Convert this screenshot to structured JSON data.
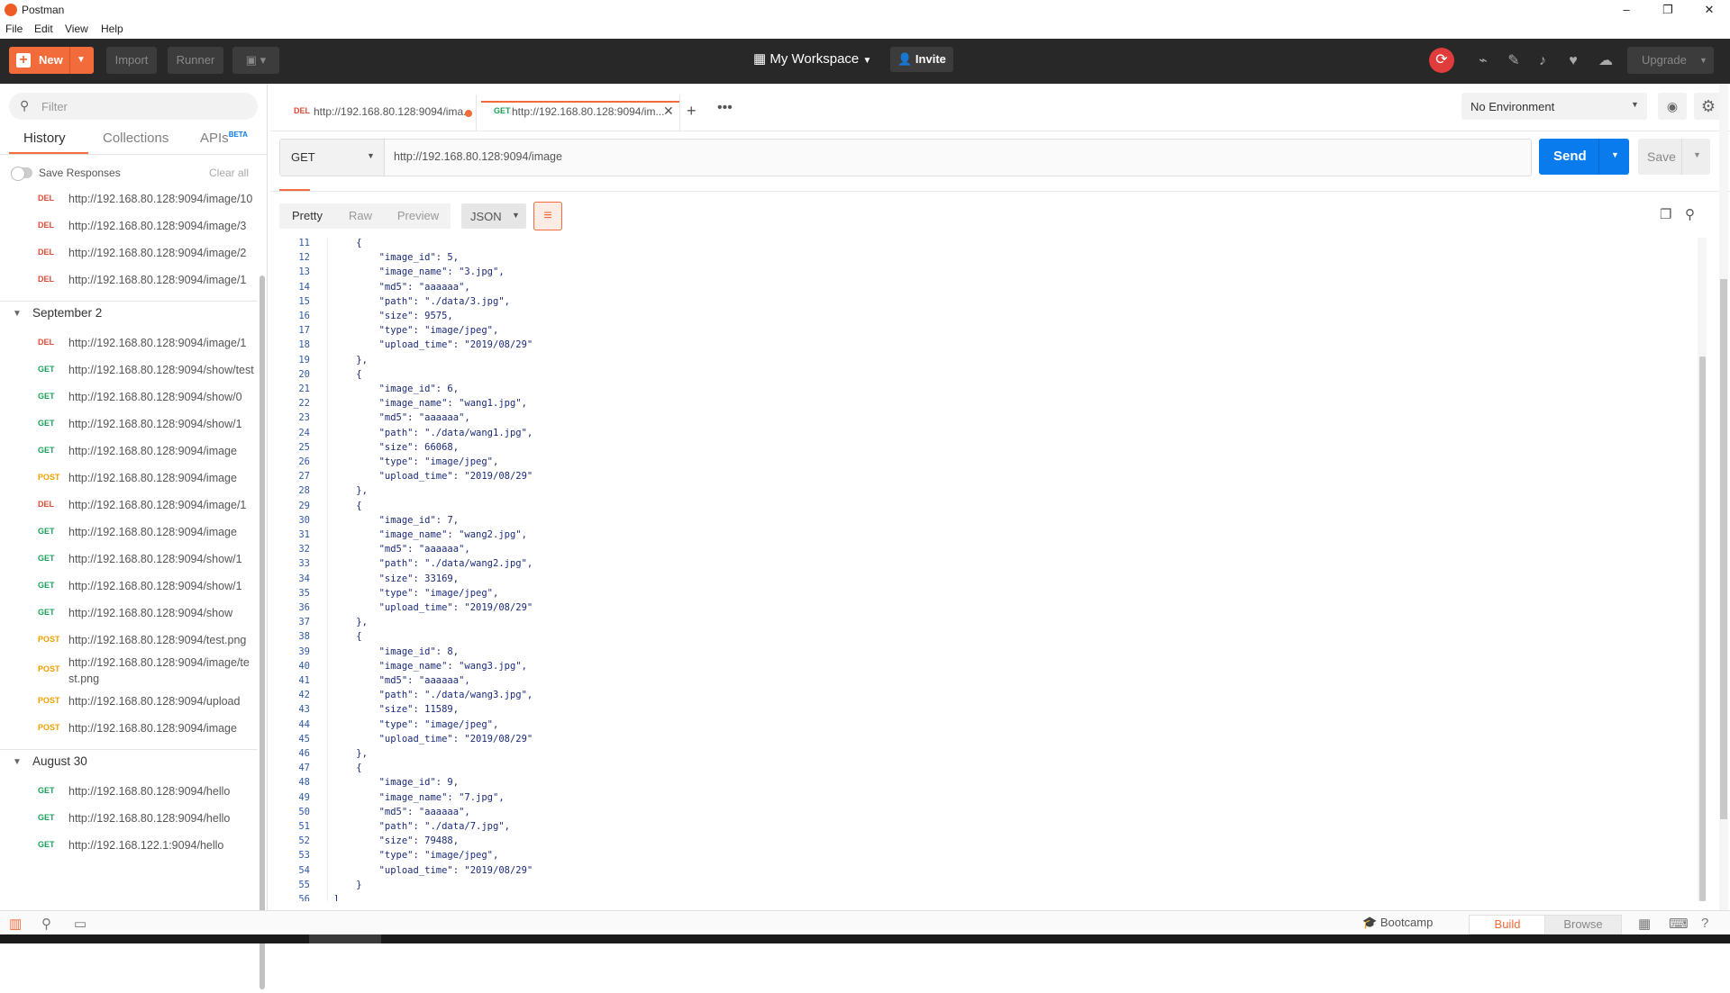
{
  "window": {
    "title": "Postman",
    "minimize": "–",
    "maximize": "❐",
    "close": "✕"
  },
  "menu": [
    "File",
    "Edit",
    "View",
    "Help"
  ],
  "toolbar": {
    "new_label": "New",
    "import_label": "Import",
    "runner_label": "Runner",
    "workspace_label": "My Workspace",
    "invite_label": "Invite",
    "upgrade_label": "Upgrade",
    "icons": [
      "sync-icon",
      "satellite-icon",
      "wrench-icon",
      "bell-icon",
      "heart-icon",
      "cloud-icon"
    ]
  },
  "sidebar": {
    "filter_placeholder": "Filter",
    "tabs": [
      "History",
      "Collections",
      "APIs"
    ],
    "apis_badge": "BETA",
    "save_responses": "Save Responses",
    "clear_all": "Clear all",
    "top_items": [
      {
        "method": "DEL",
        "url": "http://192.168.80.128:9094/image/10"
      },
      {
        "method": "DEL",
        "url": "http://192.168.80.128:9094/image/3"
      },
      {
        "method": "DEL",
        "url": "http://192.168.80.128:9094/image/2"
      },
      {
        "method": "DEL",
        "url": "http://192.168.80.128:9094/image/1"
      }
    ],
    "groups": [
      {
        "label": "September 2",
        "items": [
          {
            "method": "DEL",
            "url": "http://192.168.80.128:9094/image/1"
          },
          {
            "method": "GET",
            "url": "http://192.168.80.128:9094/show/test"
          },
          {
            "method": "GET",
            "url": "http://192.168.80.128:9094/show/0"
          },
          {
            "method": "GET",
            "url": "http://192.168.80.128:9094/show/1"
          },
          {
            "method": "GET",
            "url": "http://192.168.80.128:9094/image"
          },
          {
            "method": "POST",
            "url": "http://192.168.80.128:9094/image"
          },
          {
            "method": "DEL",
            "url": "http://192.168.80.128:9094/image/1"
          },
          {
            "method": "GET",
            "url": "http://192.168.80.128:9094/image"
          },
          {
            "method": "GET",
            "url": "http://192.168.80.128:9094/show/1"
          },
          {
            "method": "GET",
            "url": "http://192.168.80.128:9094/show/1"
          },
          {
            "method": "GET",
            "url": "http://192.168.80.128:9094/show"
          },
          {
            "method": "POST",
            "url": "http://192.168.80.128:9094/test.png"
          },
          {
            "method": "POST",
            "url": "http://192.168.80.128:9094/image/test.png"
          },
          {
            "method": "POST",
            "url": "http://192.168.80.128:9094/upload"
          },
          {
            "method": "POST",
            "url": "http://192.168.80.128:9094/image"
          }
        ]
      },
      {
        "label": "August 30",
        "items": [
          {
            "method": "GET",
            "url": "http://192.168.80.128:9094/hello"
          },
          {
            "method": "GET",
            "url": "http://192.168.80.128:9094/hello"
          },
          {
            "method": "GET",
            "url": "http://192.168.122.1:9094/hello"
          }
        ]
      }
    ]
  },
  "request_tabs": [
    {
      "method": "DEL",
      "url": "http://192.168.80.128:9094/ima..."
    },
    {
      "method": "GET",
      "url": "http://192.168.80.128:9094/im..."
    }
  ],
  "environment": {
    "selected": "No Environment"
  },
  "request": {
    "method": "GET",
    "url": "http://192.168.80.128:9094/image",
    "send_label": "Send",
    "save_label": "Save"
  },
  "response": {
    "view_tabs": [
      "Pretty",
      "Raw",
      "Preview"
    ],
    "active_view": "Pretty",
    "format": "JSON",
    "code_lines": [
      {
        "n": "11",
        "t": "    {"
      },
      {
        "n": "12",
        "t": "        \"image_id\": 5,"
      },
      {
        "n": "13",
        "t": "        \"image_name\": \"3.jpg\","
      },
      {
        "n": "14",
        "t": "        \"md5\": \"aaaaaa\","
      },
      {
        "n": "15",
        "t": "        \"path\": \"./data/3.jpg\","
      },
      {
        "n": "16",
        "t": "        \"size\": 9575,"
      },
      {
        "n": "17",
        "t": "        \"type\": \"image/jpeg\","
      },
      {
        "n": "18",
        "t": "        \"upload_time\": \"2019/08/29\""
      },
      {
        "n": "19",
        "t": "    },"
      },
      {
        "n": "20",
        "t": "    {"
      },
      {
        "n": "21",
        "t": "        \"image_id\": 6,"
      },
      {
        "n": "22",
        "t": "        \"image_name\": \"wang1.jpg\","
      },
      {
        "n": "23",
        "t": "        \"md5\": \"aaaaaa\","
      },
      {
        "n": "24",
        "t": "        \"path\": \"./data/wang1.jpg\","
      },
      {
        "n": "25",
        "t": "        \"size\": 66068,"
      },
      {
        "n": "26",
        "t": "        \"type\": \"image/jpeg\","
      },
      {
        "n": "27",
        "t": "        \"upload_time\": \"2019/08/29\""
      },
      {
        "n": "28",
        "t": "    },"
      },
      {
        "n": "29",
        "t": "    {"
      },
      {
        "n": "30",
        "t": "        \"image_id\": 7,"
      },
      {
        "n": "31",
        "t": "        \"image_name\": \"wang2.jpg\","
      },
      {
        "n": "32",
        "t": "        \"md5\": \"aaaaaa\","
      },
      {
        "n": "33",
        "t": "        \"path\": \"./data/wang2.jpg\","
      },
      {
        "n": "34",
        "t": "        \"size\": 33169,"
      },
      {
        "n": "35",
        "t": "        \"type\": \"image/jpeg\","
      },
      {
        "n": "36",
        "t": "        \"upload_time\": \"2019/08/29\""
      },
      {
        "n": "37",
        "t": "    },"
      },
      {
        "n": "38",
        "t": "    {"
      },
      {
        "n": "39",
        "t": "        \"image_id\": 8,"
      },
      {
        "n": "40",
        "t": "        \"image_name\": \"wang3.jpg\","
      },
      {
        "n": "41",
        "t": "        \"md5\": \"aaaaaa\","
      },
      {
        "n": "42",
        "t": "        \"path\": \"./data/wang3.jpg\","
      },
      {
        "n": "43",
        "t": "        \"size\": 11589,"
      },
      {
        "n": "44",
        "t": "        \"type\": \"image/jpeg\","
      },
      {
        "n": "45",
        "t": "        \"upload_time\": \"2019/08/29\""
      },
      {
        "n": "46",
        "t": "    },"
      },
      {
        "n": "47",
        "t": "    {"
      },
      {
        "n": "48",
        "t": "        \"image_id\": 9,"
      },
      {
        "n": "49",
        "t": "        \"image_name\": \"7.jpg\","
      },
      {
        "n": "50",
        "t": "        \"md5\": \"aaaaaa\","
      },
      {
        "n": "51",
        "t": "        \"path\": \"./data/7.jpg\","
      },
      {
        "n": "52",
        "t": "        \"size\": 79488,"
      },
      {
        "n": "53",
        "t": "        \"type\": \"image/jpeg\","
      },
      {
        "n": "54",
        "t": "        \"upload_time\": \"2019/08/29\""
      },
      {
        "n": "55",
        "t": "    }"
      },
      {
        "n": "56",
        "t": "]"
      }
    ]
  },
  "statusbar": {
    "bootcamp_label": "Bootcamp",
    "build_label": "Build",
    "browse_label": "Browse"
  },
  "colors": {
    "accent": "#f26b3a",
    "send": "#097bed",
    "del": "#e04a3a",
    "get": "#1aa05b",
    "post": "#f0a000"
  }
}
